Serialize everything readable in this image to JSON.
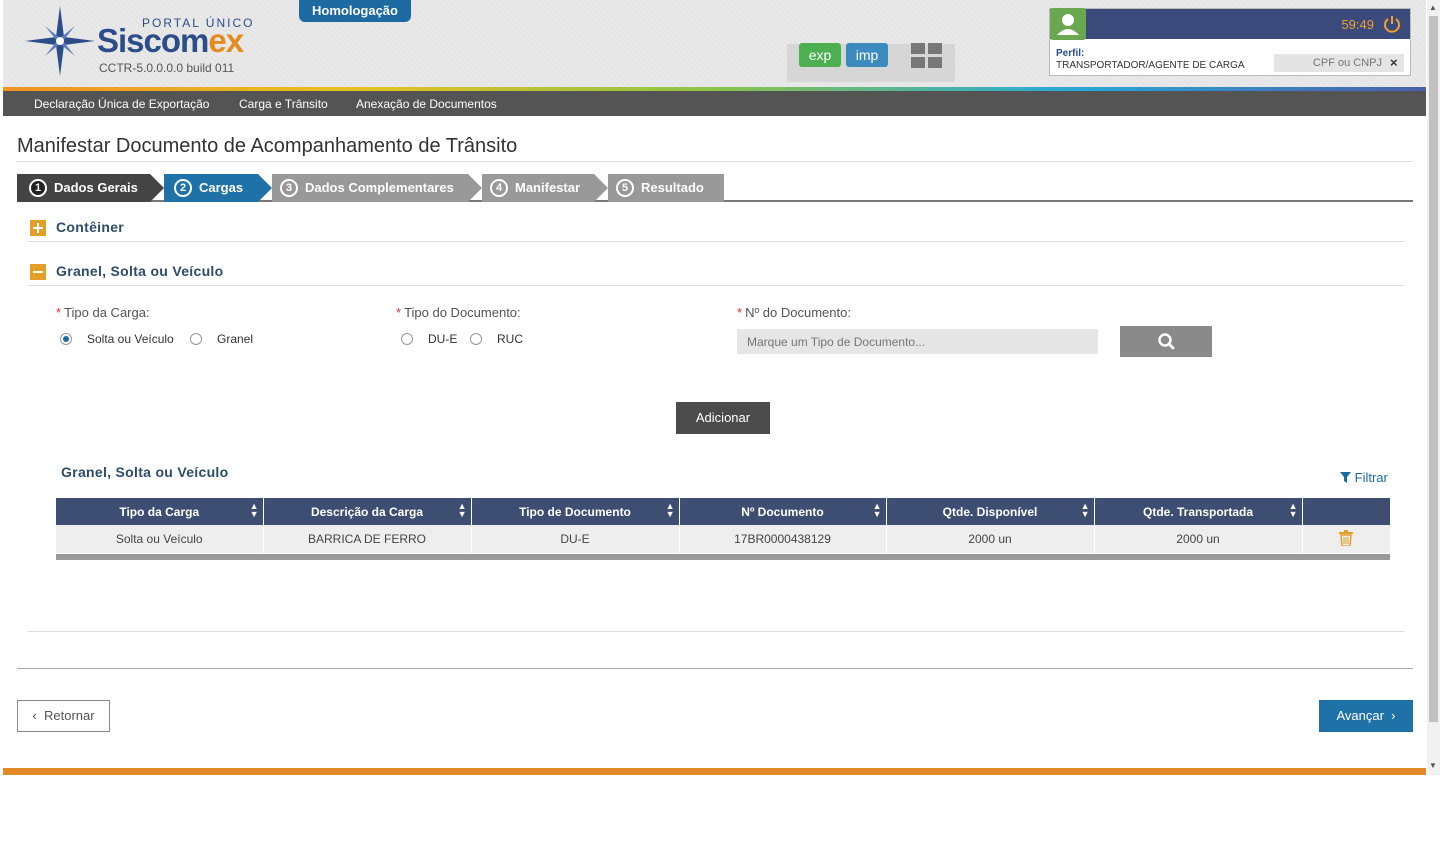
{
  "header": {
    "logo_portal": "PORTAL ÚNICO",
    "logo_name_main": "Siscom",
    "logo_name_ex": "ex",
    "build": "CCTR-5.0.0.0.0  build 011",
    "environment": "Homologação",
    "exp_label": "exp",
    "imp_label": "imp",
    "session_time": "59:49",
    "perfil_label": "Perfil:",
    "perfil_value": "TRANSPORTADOR/AGENTE DE CARGA",
    "cpf_placeholder": "CPF ou CNPJ"
  },
  "menu": [
    "Declaração Única de Exportação",
    "Carga e Trânsito",
    "Anexação de Documentos"
  ],
  "page_title": "Manifestar Documento de Acompanhamento de Trânsito",
  "wizard": {
    "steps": [
      {
        "num": "1",
        "label": "Dados Gerais",
        "state": "done"
      },
      {
        "num": "2",
        "label": "Cargas",
        "state": "active"
      },
      {
        "num": "3",
        "label": "Dados Complementares",
        "state": "pending"
      },
      {
        "num": "4",
        "label": "Manifestar",
        "state": "pending"
      },
      {
        "num": "5",
        "label": "Resultado",
        "state": "pending"
      }
    ]
  },
  "sections": {
    "container": "Contêiner",
    "granel": "Granel, Solta ou Veículo"
  },
  "form": {
    "tipo_carga_label": "Tipo da Carga:",
    "tipo_carga_options": [
      "Solta ou Veículo",
      "Granel"
    ],
    "tipo_carga_selected": "Solta ou Veículo",
    "tipo_doc_label": "Tipo do Documento:",
    "tipo_doc_options": [
      "DU-E",
      "RUC"
    ],
    "num_doc_label": "Nº do Documento:",
    "num_doc_placeholder": "Marque um Tipo de Documento...",
    "add_button": "Adicionar"
  },
  "table": {
    "title": "Granel, Solta ou Veículo",
    "filter_label": "Filtrar",
    "columns": [
      "Tipo da Carga",
      "Descrição da Carga",
      "Tipo de Documento",
      "Nº Documento",
      "Qtde. Disponível",
      "Qtde. Transportada"
    ],
    "rows": [
      [
        "Solta ou Veículo",
        "BARRICA DE FERRO",
        "DU-E",
        "17BR0000438129",
        "2000 un",
        "2000 un"
      ]
    ]
  },
  "nav": {
    "back_label": "Retornar",
    "next_label": "Avançar"
  },
  "colors": {
    "primary": "#1e72a8",
    "header_dark": "#3e4e72",
    "accent_orange": "#e38a26",
    "success_green": "#4caf50"
  }
}
